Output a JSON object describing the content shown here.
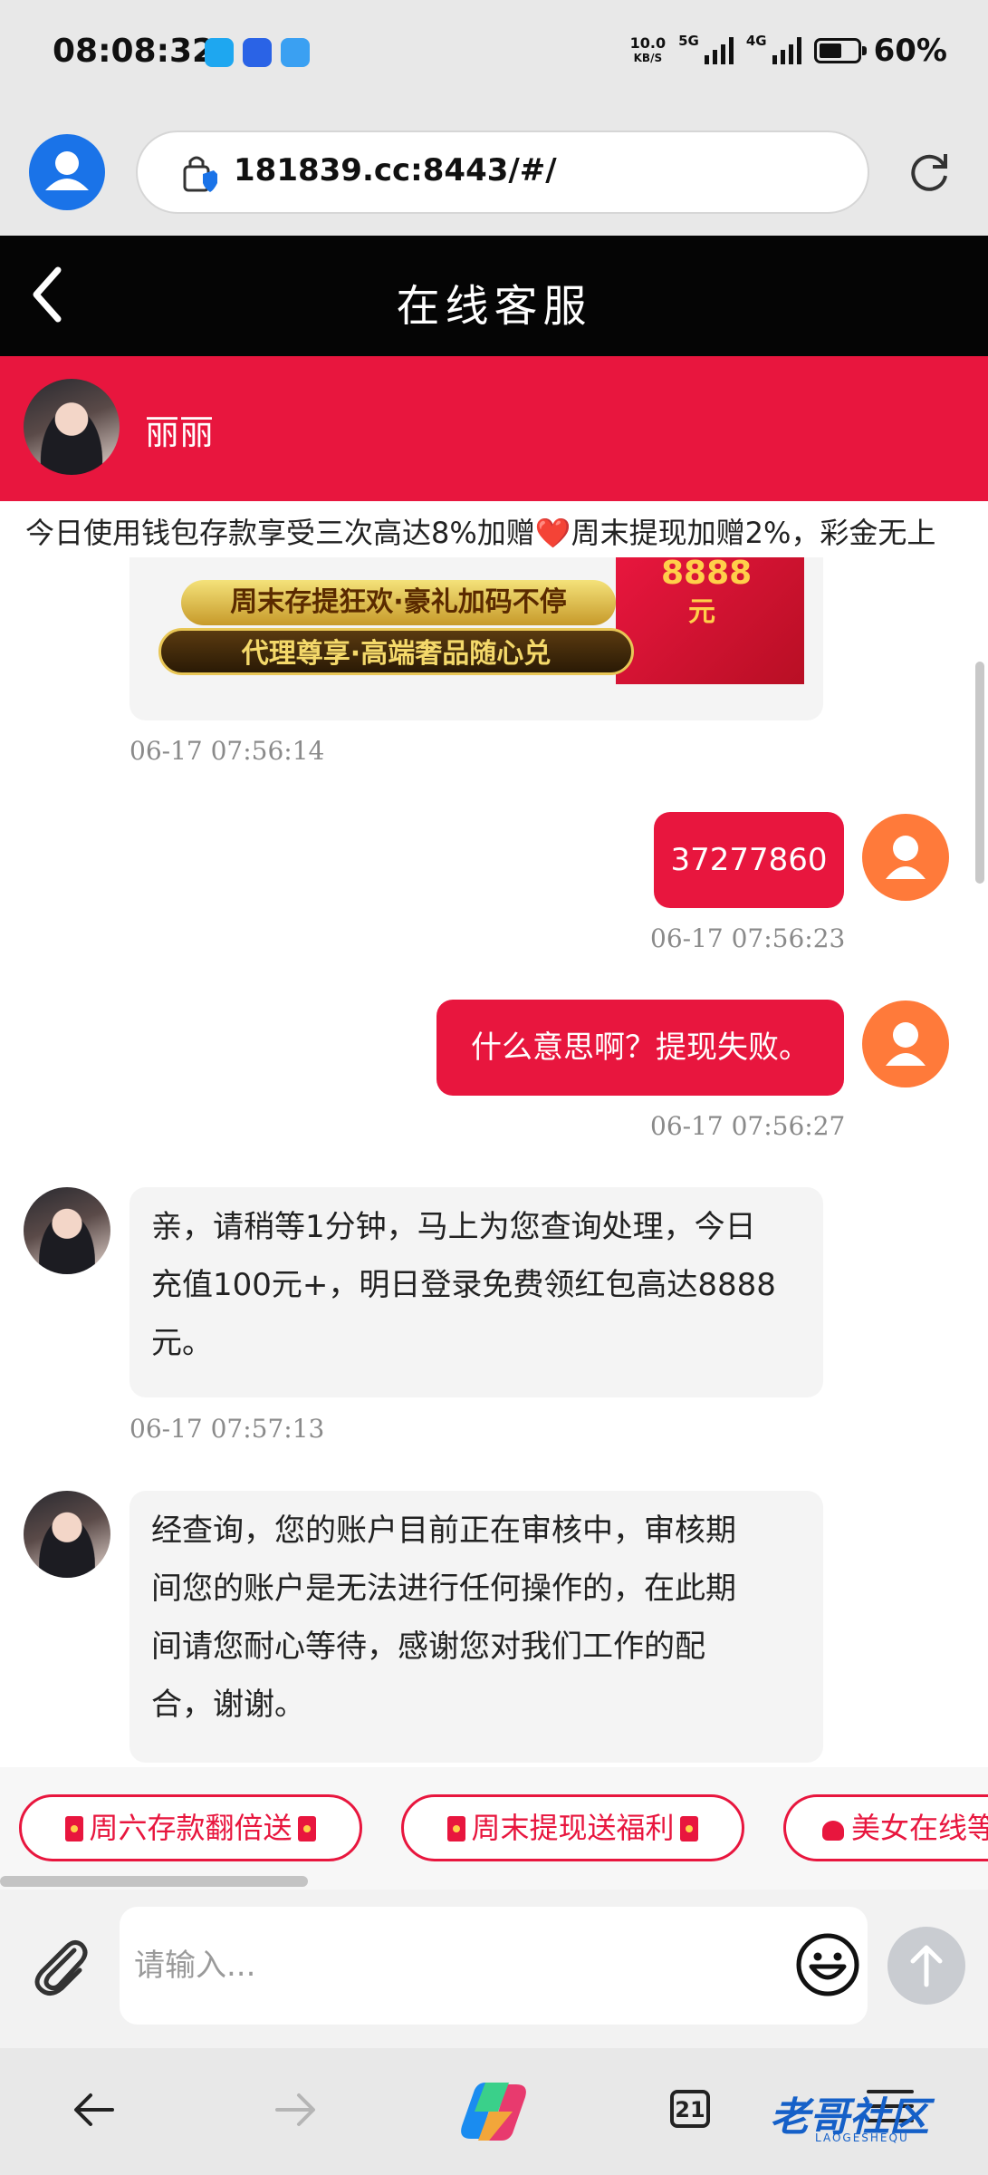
{
  "status_bar": {
    "time": "08:08:32",
    "net_speed_value": "10.0",
    "net_speed_unit": "KB/S",
    "signal1_label": "5G",
    "signal2_label": "4G",
    "battery_level": 0.6,
    "battery_text": "60%"
  },
  "browser": {
    "url": "181839.cc:8443/#/"
  },
  "header": {
    "title": "在线客服"
  },
  "agent": {
    "name": "丽丽"
  },
  "marquee": {
    "text": "今日使用钱包存款享受三次高达8%加赠❤️周末提现加赠2%，彩金无上"
  },
  "banner": {
    "line1": "周末存提狂欢·豪礼加码不停",
    "line2": "代理尊享·高端奢品随心兑",
    "amount": "8888",
    "unit": "元"
  },
  "messages": [
    {
      "side": "left",
      "kind": "image",
      "time": "06-17 07:56:14"
    },
    {
      "side": "right",
      "text": "37277860",
      "time": "06-17 07:56:23"
    },
    {
      "side": "right",
      "text": "什么意思啊？提现失败。",
      "time": "06-17 07:56:27"
    },
    {
      "side": "left",
      "lines": [
        "亲，请稍等1分钟，马上为您查询处理，今日",
        "充值100元+，明日登录免费领红包高达8888",
        "元。"
      ],
      "time": "06-17 07:57:13"
    },
    {
      "side": "left",
      "lines": [
        "经查询，您的账户目前正在审核中，审核期",
        "间您的账户是无法进行任何操作的，在此期",
        "间请您耐心等待，感谢您对我们工作的配",
        "合，谢谢。"
      ]
    }
  ],
  "quick_replies": [
    {
      "label": "周六存款翻倍送"
    },
    {
      "label": "周末提现送福利"
    },
    {
      "label": "美女在线等"
    }
  ],
  "input": {
    "placeholder": "请输入..."
  },
  "browser_nav": {
    "tab_count": "21",
    "watermark": "老哥社区",
    "watermark_sub": "LAOGESHEQU"
  },
  "colors": {
    "accent_red": "#e8163e",
    "header_black": "#050505",
    "user_avatar_orange": "#ff7a3a",
    "browser_blue": "#1a73e8"
  },
  "icons": [
    "wifi-calling-icon",
    "baidu-icon",
    "weather-icon",
    "lock-icon",
    "reload-icon",
    "back-icon",
    "attach-icon",
    "emoji-icon",
    "send-arrow-icon",
    "nav-back-icon",
    "nav-forward-icon",
    "copilot-icon",
    "menu-icon"
  ]
}
